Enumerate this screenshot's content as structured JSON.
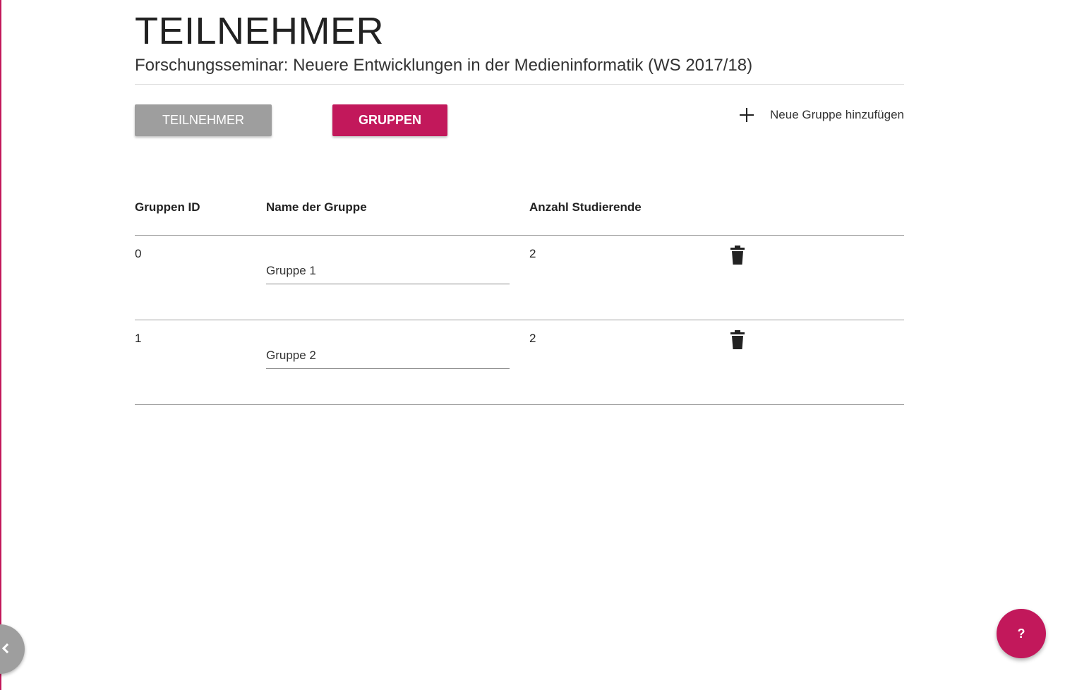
{
  "header": {
    "title": "TEILNEHMER",
    "subtitle": "Forschungsseminar: Neuere Entwicklungen in der Medieninformatik (WS 2017/18)"
  },
  "tabs": {
    "participants_label": "TEILNEHMER",
    "groups_label": "GRUPPEN"
  },
  "add_group": {
    "label": "Neue Gruppe hinzufügen",
    "icon": "plus-icon"
  },
  "table": {
    "columns": [
      "Gruppen ID",
      "Name der Gruppe",
      "Anzahl Studierende"
    ],
    "rows": [
      {
        "id": "0",
        "name": "Gruppe 1",
        "count": "2"
      },
      {
        "id": "1",
        "name": "Gruppe 2",
        "count": "2"
      }
    ]
  },
  "help": {
    "label": "?"
  },
  "colors": {
    "accent": "#c2185b",
    "inactive_tab": "#9e9e9e"
  }
}
